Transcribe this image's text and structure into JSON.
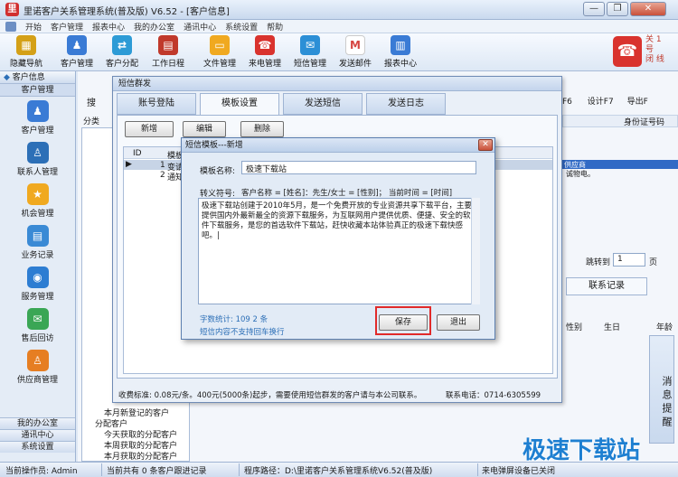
{
  "window": {
    "title": "里诺客户关系管理系统(普及版) V6.52 - [客户信息]",
    "logo": "里"
  },
  "menu": [
    "开始",
    "客户管理",
    "报表中心",
    "我的办公室",
    "通讯中心",
    "系统设置",
    "帮助"
  ],
  "toolbar": [
    {
      "label": "隐藏导航",
      "icon": "hide-nav-icon",
      "color": "#d4a017",
      "glyph": "▦"
    },
    {
      "label": "客户管理",
      "icon": "customers-icon",
      "color": "#3a7bd5",
      "glyph": "👥"
    },
    {
      "label": "客户分配",
      "icon": "assign-icon",
      "color": "#2d9bd6",
      "glyph": "⇄"
    },
    {
      "label": "工作日程",
      "icon": "calendar-icon",
      "color": "#c0392b",
      "glyph": "▤"
    },
    {
      "label": "文件管理",
      "icon": "folder-icon",
      "color": "#f0a920",
      "glyph": "▭"
    },
    {
      "label": "来电管理",
      "icon": "phone-icon",
      "color": "#d9332e",
      "glyph": "☎"
    },
    {
      "label": "短信管理",
      "icon": "sms-icon",
      "color": "#2c8fd6",
      "glyph": "✉"
    },
    {
      "label": "发送邮件",
      "icon": "mail-icon",
      "color": "#d64541",
      "glyph": "M"
    },
    {
      "label": "报表中心",
      "icon": "report-icon",
      "color": "#3a7bd5",
      "glyph": "▥"
    }
  ],
  "hotline": {
    "lines": [
      "关",
      "号",
      "闭"
    ],
    "label": "1号"
  },
  "leftnav": {
    "header": "客户信息",
    "tab": "客户管理",
    "items": [
      {
        "label": "客户管理",
        "icon": "customers-icon",
        "color": "#3a7bd5",
        "glyph": "●"
      },
      {
        "label": "联系人管理",
        "icon": "contact-icon",
        "color": "#2c6fb7",
        "glyph": "●"
      },
      {
        "label": "机会管理",
        "icon": "star-icon",
        "color": "#f0a920",
        "glyph": "★"
      },
      {
        "label": "业务记录",
        "icon": "business-icon",
        "color": "#3a8ad5",
        "glyph": "▤"
      },
      {
        "label": "服务管理",
        "icon": "service-icon",
        "color": "#2d7dd2",
        "glyph": "◉"
      },
      {
        "label": "售后回访",
        "icon": "followup-icon",
        "color": "#3aa655",
        "glyph": "✉"
      },
      {
        "label": "供应商管理",
        "icon": "supplier-icon",
        "color": "#e67e22",
        "glyph": "♙"
      }
    ],
    "bottom": [
      "我的办公室",
      "通讯中心",
      "系统设置"
    ]
  },
  "main": {
    "search_label": "搜",
    "category_label": "分类",
    "right_toolbar": [
      "F6",
      "设计F7",
      "导出F"
    ],
    "columns": [
      "身份证号码"
    ],
    "row_snippet": [
      "供应商",
      "诚物电。"
    ],
    "jump_label": "跳转到",
    "jump_value": "1",
    "page_label": "页",
    "tab_contact": "联系记录",
    "col2": [
      "性别",
      "生日",
      "年龄"
    ],
    "side_tip": "消息提醒",
    "tree_items": [
      "本月新登记的客户",
      "分配客户",
      "今天获取的分配客户",
      "本周获取的分配客户",
      "本月获取的分配客户"
    ]
  },
  "sms_dialog": {
    "title": "短信群发",
    "tabs": [
      "账号登陆",
      "模板设置",
      "发送短信",
      "发送日志"
    ],
    "buttons": [
      "新增",
      "编辑",
      "删除"
    ],
    "table_headers": [
      "ID",
      "模板名"
    ],
    "rows": [
      {
        "id": "1",
        "name": "变请"
      },
      {
        "id": "2",
        "name": "通知"
      }
    ],
    "footer": "收费标准: 0.08元/条。400元(5000条)起步，需要使用短信群发的客户请与本公司联系。",
    "phone": "联系电话：0714-6305599"
  },
  "template_dialog": {
    "title": "短信模板---新增",
    "name_label": "模板名称:",
    "name_value": "极速下载站",
    "symbol_label": "转义符号:",
    "symbols": "客户名称 = [姓名]：先生/女士 = [性别]； 当前时间 = [时间]",
    "content": "极速下载站创建于2010年5月，是一个免费开放的专业资源共享下载平台，主要提供国内外最新最全的资源下载服务，为互联网用户提供优质、便捷、安全的软件下载服务，是您的首选软件下载站，赶快收藏本站体验真正的极速下载快感吧。|",
    "word_count": "字数统计: 109   2 条",
    "no_newline": "短信内容不支持回车换行",
    "save": "保存",
    "exit": "退出"
  },
  "status": {
    "operator": "当前操作员: Admin",
    "count": "当前共有 0 条客户跟进记录",
    "path": "程序路径：D:\\里诺客户关系管理系统V6.52(普及版)",
    "popup": "来电弹屏设备已关闭"
  },
  "watermark": "极速下载站"
}
